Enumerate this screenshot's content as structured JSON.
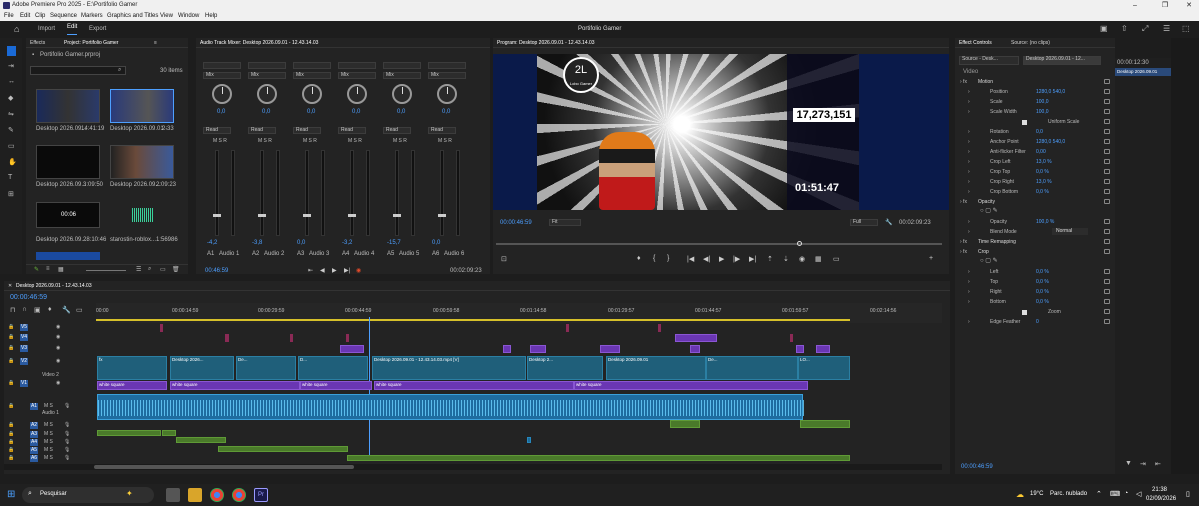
{
  "titlebar": {
    "title": "Adobe Premiere Pro 2025 - E:\\Portifolio Gamer"
  },
  "menu": [
    "File",
    "Edit",
    "Clip",
    "Sequence",
    "Markers",
    "Graphics and Titles",
    "View",
    "Window",
    "Help"
  ],
  "workspace": {
    "tabs": [
      "Import",
      "Edit",
      "Export"
    ],
    "active": "Edit",
    "project_title": "Portifolio Gamer"
  },
  "project": {
    "tabs": [
      "Effects",
      "Project: Portifolio Gamer"
    ],
    "file": "Portifolio Gamer.prproj",
    "item_count": "30 items",
    "items": [
      {
        "name": "Desktop 2026.09...",
        "dur": "14:41:19"
      },
      {
        "name": "Desktop 2026.09.01 -",
        "dur": "2:33"
      },
      {
        "name": "Desktop 2026.09...",
        "dur": "3:09:50"
      },
      {
        "name": "Desktop 2026.09...",
        "dur": "2:09:23"
      },
      {
        "name": "Desktop 2026.09...",
        "dur": "28:10:46",
        "overlay": "00:06"
      },
      {
        "name": "starostin-roblox...",
        "dur": "1:56986"
      }
    ]
  },
  "mixer": {
    "title": "Audio Track Mixer: Desktop 2026.09.01 - 12.43.14.03",
    "channels": [
      {
        "label": "A1",
        "name": "Audio 1",
        "mode": "Mix",
        "read": "Read",
        "val": "0,0",
        "db": "-4,2"
      },
      {
        "label": "A2",
        "name": "Audio 2",
        "mode": "Mix",
        "read": "Read",
        "val": "0,0",
        "db": "-3,8"
      },
      {
        "label": "A3",
        "name": "Audio 3",
        "mode": "Mix",
        "read": "Read",
        "val": "0,0",
        "db": "0,0"
      },
      {
        "label": "A4",
        "name": "Audio 4",
        "mode": "Mix",
        "read": "Read",
        "val": "0,0",
        "db": "-3,2"
      },
      {
        "label": "A5",
        "name": "Audio 5",
        "mode": "Mix",
        "read": "Read",
        "val": "0,0",
        "db": "-15,7"
      },
      {
        "label": "A6",
        "name": "Audio 6",
        "mode": "Mix",
        "read": "Read",
        "val": "0,0",
        "db": "0,0"
      }
    ],
    "time_left": "00:46:59",
    "time_right": "00:02:09:23"
  },
  "program": {
    "title": "Program: Desktop 2026.09.01 - 12.43.14.03",
    "timecode": "00:00:46:59",
    "fit": "Fit",
    "quality": "Full",
    "duration": "00:02:09:23",
    "overlay_count": "17,273,151",
    "overlay_timer": "01:51:47",
    "logo_text": "2L",
    "logo_sub": "Lobo Gamer"
  },
  "effect_controls": {
    "tabs": [
      "Effect Controls",
      "Source: (no clips)"
    ],
    "source": "Source - Desk...",
    "clip": "Desktop 2026.09.01 - 12...",
    "timecode_mini": "00:00:12:30",
    "clip_mini": "Desktop 2026.09.01",
    "section_video": "Video",
    "rows": [
      {
        "label": "Motion",
        "value": "",
        "level": 0
      },
      {
        "label": "Position",
        "value": "1280,0   540,0",
        "level": 1
      },
      {
        "label": "Scale",
        "value": "100,0",
        "level": 1
      },
      {
        "label": "Scale Width",
        "value": "100,0",
        "level": 1
      },
      {
        "label": "Uniform Scale",
        "value": "",
        "level": 2
      },
      {
        "label": "Rotation",
        "value": "0,0",
        "level": 1
      },
      {
        "label": "Anchor Point",
        "value": "1280,0   540,0",
        "level": 1
      },
      {
        "label": "Anti-flicker Filter",
        "value": "0,00",
        "level": 1
      },
      {
        "label": "Crop Left",
        "value": "13,0 %",
        "level": 1
      },
      {
        "label": "Crop Top",
        "value": "0,0 %",
        "level": 1
      },
      {
        "label": "Crop Right",
        "value": "13,0 %",
        "level": 1
      },
      {
        "label": "Crop Bottom",
        "value": "0,0 %",
        "level": 1
      },
      {
        "label": "Opacity",
        "value": "",
        "level": 0
      },
      {
        "label": "Opacity",
        "value": "100,0 %",
        "level": 1
      },
      {
        "label": "Blend Mode",
        "value": "Normal",
        "level": 1
      },
      {
        "label": "Time Remapping",
        "value": "",
        "level": 0
      },
      {
        "label": "Crop",
        "value": "",
        "level": 0
      },
      {
        "label": "Left",
        "value": "0,0 %",
        "level": 1
      },
      {
        "label": "Top",
        "value": "0,0 %",
        "level": 1
      },
      {
        "label": "Right",
        "value": "0,0 %",
        "level": 1
      },
      {
        "label": "Bottom",
        "value": "0,0 %",
        "level": 1
      },
      {
        "label": "Zoom",
        "value": "",
        "level": 2
      },
      {
        "label": "Edge Feather",
        "value": "0",
        "level": 1
      }
    ],
    "bottom_time": "00:00:46:59"
  },
  "timeline": {
    "tab": "Desktop 2026.09.01 - 12.43.14.03",
    "timecode": "00:00:46:59",
    "ruler": [
      "00:00",
      "00:00:14:59",
      "00:00:29:59",
      "00:00:44:59",
      "00:00:59:58",
      "00:01:14:58",
      "00:01:29:57",
      "00:01:44:57",
      "00:01:59:57",
      "00:02:14:56"
    ],
    "tracks_video": [
      "V5",
      "V4",
      "V3",
      "V2",
      "V1"
    ],
    "video2_name": "Video 2",
    "tracks_audio": [
      "A1",
      "A2",
      "A3",
      "A4",
      "A5",
      "A6"
    ],
    "audio1_name": "Audio 1",
    "clip_labels": {
      "v2_main": "Desktop 2026.09.01 - 12.43.14.03.mp4 [V]",
      "v2_a": "Desktop 2026...",
      "v2_b": "Desktop 2...",
      "v2_c": "Desktop 2026.09.01",
      "v1": "white square",
      "fx": "fx",
      "v2_d": "De...",
      "v2_e": "D...",
      "v2_f": "LO..."
    }
  },
  "taskbar": {
    "search": "Pesquisar",
    "weather_temp": "19°C",
    "weather_desc": "Parc. nublado",
    "time": "21:38",
    "date": "02/09/2026"
  }
}
